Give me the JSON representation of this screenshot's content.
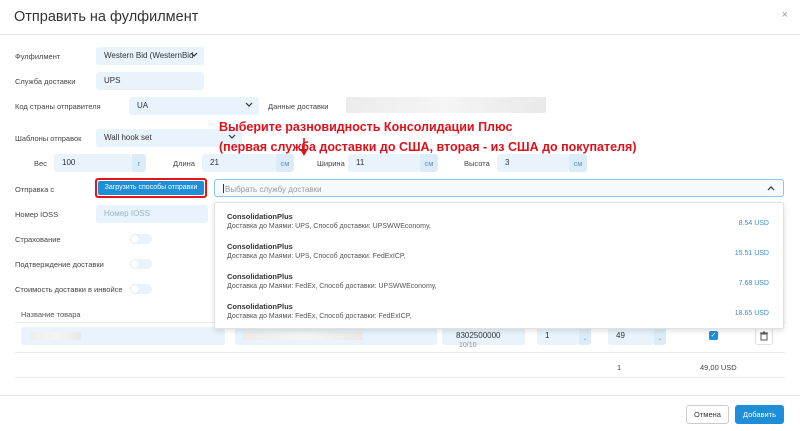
{
  "dialog": {
    "title": "Отправить на фулфилмент",
    "close_glyph": "×"
  },
  "form": {
    "fulfillment_label": "Фулфилмент",
    "fulfillment_value": "Western Bid (WesternBid",
    "delivery_service_label": "Служба доставки",
    "delivery_service_value": "UPS",
    "sender_country_label": "Код страны отправителя",
    "sender_country_value": "UA",
    "delivery_data_label": "Данные доставки",
    "templates_label": "Шаблоны отправок",
    "templates_value": "Wall hook set",
    "weight_label": "Вес",
    "weight_value": "100",
    "weight_unit": "г",
    "length_label": "Длина",
    "length_value": "21",
    "length_unit": "см",
    "width_label": "Ширина",
    "width_value": "11",
    "width_unit": "см",
    "height_label": "Высота",
    "height_value": "3",
    "height_unit": "см",
    "ship_from_label": "Отправка с",
    "load_methods_button": "Загрузить способы отправки",
    "service_placeholder": "Выбрать службу доставки",
    "ioss_label": "Номер IOSS",
    "ioss_placeholder": "Номер IOSS",
    "insurance_label": "Страхование",
    "confirmation_label": "Подтверждение доставки",
    "invoice_cost_label": "Стоимость доставки в инвойсе"
  },
  "annotation": {
    "line1": "Выберите разновидность Консолидации Плюс",
    "line2": "(первая служба доставки до США, вторая - из США до покупателя)"
  },
  "dropdown": {
    "options": [
      {
        "name": "ConsolidationPlus",
        "desc": "Доставка до Маями: UPS, Способ доставки: UPSWWEconomy,",
        "price": "8.54 USD"
      },
      {
        "name": "ConsolidationPlus",
        "desc": "Доставка до Маями: UPS, Способ доставки: FedExICP,",
        "price": "15.51 USD"
      },
      {
        "name": "ConsolidationPlus",
        "desc": "Доставка до Маями: FedEx, Способ доставки: UPSWWEconomy,",
        "price": "7.68 USD"
      },
      {
        "name": "ConsolidationPlus",
        "desc": "Доставка до Маями: FedEx, Способ доставки: FedExICP,",
        "price": "18.65 USD"
      }
    ]
  },
  "products": {
    "name_header": "Название товара",
    "row": {
      "hs_code": "8302500000",
      "hs_counter": "10/10",
      "quantity": "1",
      "price": "49"
    },
    "totals": {
      "quantity": "1",
      "amount": "49,00 USD"
    }
  },
  "footer": {
    "cancel_label": "Отмена",
    "add_label": "Добавить"
  },
  "colors": {
    "accent": "#1e8ed8",
    "annotation": "#e0101b",
    "field_bg": "#e8f3fb"
  }
}
